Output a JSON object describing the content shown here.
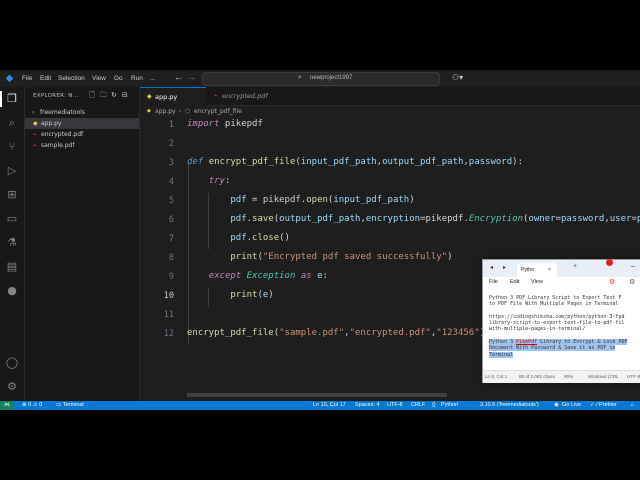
{
  "titlebar": {
    "menu": [
      "File",
      "Edit",
      "Selection",
      "View",
      "Go",
      "Run",
      "..."
    ],
    "search_text": "newproject1997"
  },
  "sidebar": {
    "title": "EXPLORER: N...",
    "folder": "freemediatools",
    "files": [
      {
        "name": "app.py",
        "icon": "py",
        "color": "#f5c542",
        "selected": true
      },
      {
        "name": "encrypted.pdf",
        "icon": "pdf",
        "color": "#f14c4c",
        "selected": false
      },
      {
        "name": "sample.pdf",
        "icon": "pdf",
        "color": "#f14c4c",
        "selected": false
      }
    ]
  },
  "tabs": [
    {
      "label": "app.py",
      "active": true
    },
    {
      "label": "encrypted.pdf",
      "active": false
    }
  ],
  "breadcrumb": {
    "file": "app.py",
    "symbol": "encrypt_pdf_file"
  },
  "editor": {
    "line_numbers": [
      "1",
      "2",
      "3",
      "4",
      "5",
      "6",
      "7",
      "8",
      "9",
      "10",
      "11",
      "12"
    ],
    "current_line": "10"
  },
  "statusbar": {
    "problems": "⊗ 0 ⚠ 0",
    "terminal": "Terminal",
    "cursor": "Ln 10, Col 17",
    "spaces": "Spaces: 4",
    "encoding": "UTF-8",
    "eol": "CRLF",
    "language": "Python",
    "interpreter": "3.10.5 ('freemediatools')",
    "golive": "Go Live",
    "prettier": "Prettier"
  },
  "notepad": {
    "tab": "Pytho",
    "menu": [
      "File",
      "Edit",
      "View"
    ],
    "content_1": "Python 3 PDF Library Script to Export Text F\nto PDF File With Multiple Pages in Terminal",
    "content_2": "https://codingshiksha.com/python/python-3-fpd\nlibrary-script-to-export-text-file-to-pdf-fil\nwith-multiple-pages-in-terminal/",
    "content_3_a": "Python 3 ",
    "content_3_b": "PikePdf",
    "content_3_c": " Library to Encrypt & Lock PDF",
    "content_3_d": "Document With Password & Save it as PDF in",
    "content_3_e": "Terminal",
    "status": {
      "pos": "Ln 8, Col 1",
      "chars": "89 of 2,062 chara",
      "zoom": "90%",
      "eol": "Windows (CRL",
      "enc": "UTF-8"
    }
  }
}
